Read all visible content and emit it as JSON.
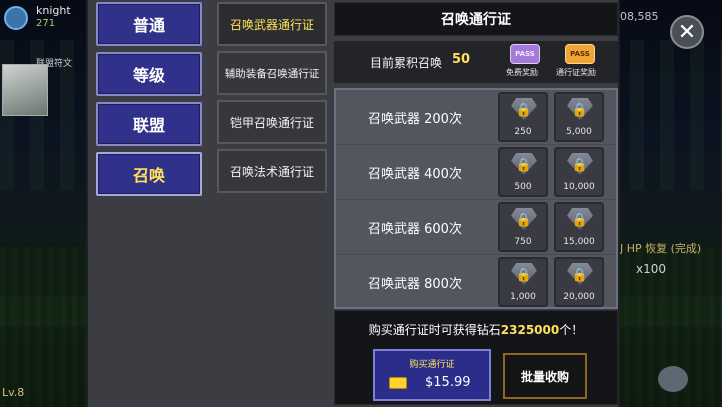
{
  "background": {
    "player_name": "knight",
    "player_stat": "271",
    "guild_tag": "联盟符文",
    "bottom_level": "Lv.8",
    "gold_top": "08,585",
    "hp_info": "J HP 恢复 (完成)",
    "gem_count": "x100"
  },
  "close_label": "✕",
  "categories": [
    {
      "label": "普通",
      "active": false
    },
    {
      "label": "等级",
      "active": false
    },
    {
      "label": "联盟",
      "active": false
    },
    {
      "label": "召唤",
      "active": true
    }
  ],
  "subcategories": [
    {
      "label": "召唤武器通行证",
      "active": true
    },
    {
      "label": "辅助装备召唤通行证",
      "active": false
    },
    {
      "label": "铠甲召唤通行证",
      "active": false
    },
    {
      "label": "召唤法术通行证",
      "active": false
    }
  ],
  "detail": {
    "title": "召唤通行证",
    "summary_label": "目前累积召唤",
    "summary_value": "50",
    "free_pass_icon": "PASS",
    "free_pass_label": "免费奖励",
    "paid_pass_icon": "PASS",
    "paid_pass_label": "通行证奖励"
  },
  "rows": [
    {
      "label": "召唤武器 200次",
      "free": "250",
      "paid": "5,000"
    },
    {
      "label": "召唤武器 400次",
      "free": "500",
      "paid": "10,000"
    },
    {
      "label": "召唤武器 600次",
      "free": "750",
      "paid": "15,000"
    },
    {
      "label": "召唤武器 800次",
      "free": "1,000",
      "paid": "20,000"
    }
  ],
  "purchase": {
    "msg_prefix": "购买通行证时可获得钻石",
    "msg_amount": "2325000",
    "msg_suffix": "个！",
    "buy_title": "购买通行证",
    "buy_price": "$15.99",
    "bulk_label": "批量收购"
  },
  "icons": {
    "lock": "🔒",
    "gem": "diamond-icon"
  }
}
